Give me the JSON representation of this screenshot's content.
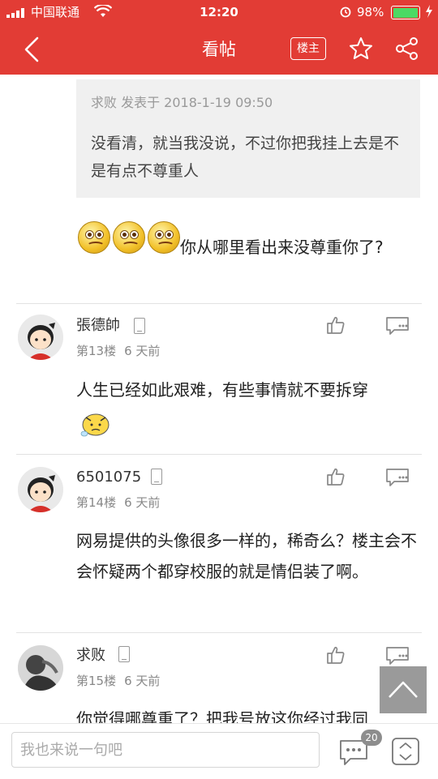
{
  "status_bar": {
    "carrier": "中国联通",
    "time": "12:20",
    "battery": "98%",
    "icons": [
      "signal-icon",
      "wifi-icon",
      "alarm-icon",
      "battery-icon",
      "charging-icon"
    ]
  },
  "nav": {
    "title": "看帖",
    "louzhu_label": "楼主",
    "icons": [
      "back-icon",
      "star-icon",
      "share-icon"
    ]
  },
  "quote": {
    "meta": "求败 发表于 2018-1-19 09:50",
    "text": "没看清，就当我没说，不过你把我挂上去是不是有点不尊重人"
  },
  "reply_top": {
    "text": "你从哪里看出来没尊重你了?",
    "emoji_count": 3
  },
  "comments": [
    {
      "user": "張德帥",
      "floor": "第13楼",
      "time": "6 天前",
      "text": "人生已经如此艰难，有些事情就不要拆穿"
    },
    {
      "user": "6501075",
      "floor": "第14楼",
      "time": "6 天前",
      "text": "网易提供的头像很多一样的，稀奇么？楼主会不会怀疑两个都穿校服的就是情侣装了啊。"
    },
    {
      "user": "求败",
      "floor": "第15楼",
      "time": "6 天前",
      "text": "你觉得哪尊重了？把我号放这你经过我同"
    }
  ],
  "bottom_bar": {
    "input_placeholder": "我也来说一句吧",
    "comment_count": "20",
    "icons": [
      "comment-icon",
      "scroll-toggle-icon",
      "scroll-top-icon"
    ]
  },
  "colors": {
    "brand_red": "#e23c35",
    "quote_bg": "#f0f0f0",
    "divider": "#e2e2e2"
  }
}
